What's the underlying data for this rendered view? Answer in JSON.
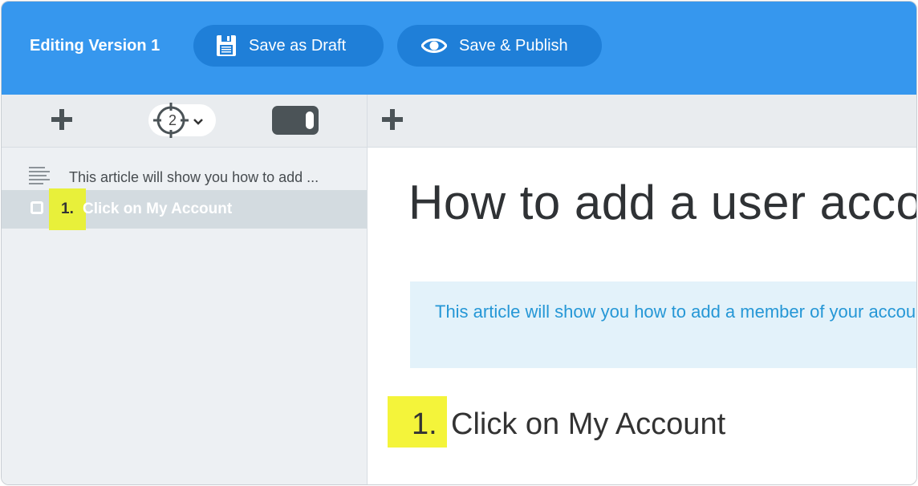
{
  "header": {
    "title": "Editing Version 1",
    "save_draft_label": "Save as Draft",
    "save_publish_label": "Save & Publish",
    "color": "#3697ee"
  },
  "left_panel": {
    "toolbar": {
      "add_icon": "plus-icon",
      "target_count": "2",
      "target_icon": "crosshair-icon",
      "toggle_icon": "toggle-switch-icon"
    },
    "outline": {
      "intro_text": "This article will show you how to add ...",
      "steps": [
        {
          "number": "1.",
          "label": "Click on My Account"
        }
      ]
    }
  },
  "right_panel": {
    "toolbar": {
      "add_icon": "plus-icon"
    },
    "article": {
      "title": "How to add a user acco",
      "intro": "This article will show you how to add a member of your account.",
      "steps": [
        {
          "number": "1.",
          "heading": "Click on My Account"
        }
      ]
    }
  },
  "colors": {
    "highlight": "#f4f43a",
    "intro_box_bg": "#e3f2fa",
    "intro_text": "#2597d6"
  }
}
